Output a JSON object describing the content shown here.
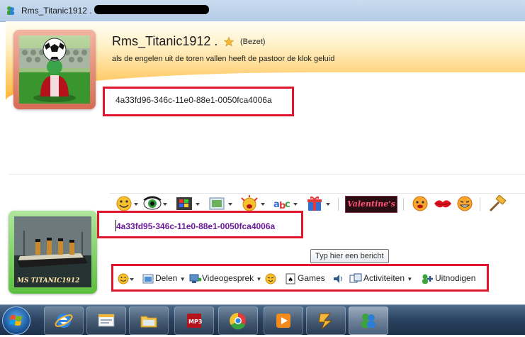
{
  "window": {
    "title": "Rms_Titanic1912 ."
  },
  "contact": {
    "name": "Rms_Titanic1912 .",
    "status": "(Bezet)",
    "personal_message": "als de engelen uit de toren vallen heeft de pastoor de klok geluid"
  },
  "conversation": {
    "message": "4a33fd96-346c-11e0-88e1-0050fca4006a"
  },
  "toolbar": {
    "icons": [
      "emoticon-icon",
      "wink-icon",
      "video-clip-icon",
      "background-icon",
      "nudge-icon",
      "handwriting-icon",
      "gift-icon",
      "valentine-icon",
      "smiley-icon",
      "kiss-icon",
      "laugh-icon",
      "hammer-icon"
    ],
    "valentine_label": "Valentine's"
  },
  "self": {
    "caption": "MS TITANIC1912"
  },
  "input": {
    "text": "4a33fd95-346c-11e0-88e1-0050fca4006a",
    "tooltip": "Typ hier een bericht"
  },
  "bottom_bar": {
    "delen": "Delen",
    "videogesprek": "Videogesprek",
    "games": "Games",
    "activiteiten": "Activiteiten",
    "uitnodigen": "Uitnodigen"
  },
  "taskbar": {
    "apps": [
      "internet-explorer",
      "messenger-mail",
      "file-explorer",
      "media-center",
      "chrome",
      "media-player",
      "winamp",
      "messenger"
    ]
  },
  "colors": {
    "highlight_box": "#e3152c",
    "header_orange": "#ffb22e",
    "input_text": "#6a1b9a"
  }
}
